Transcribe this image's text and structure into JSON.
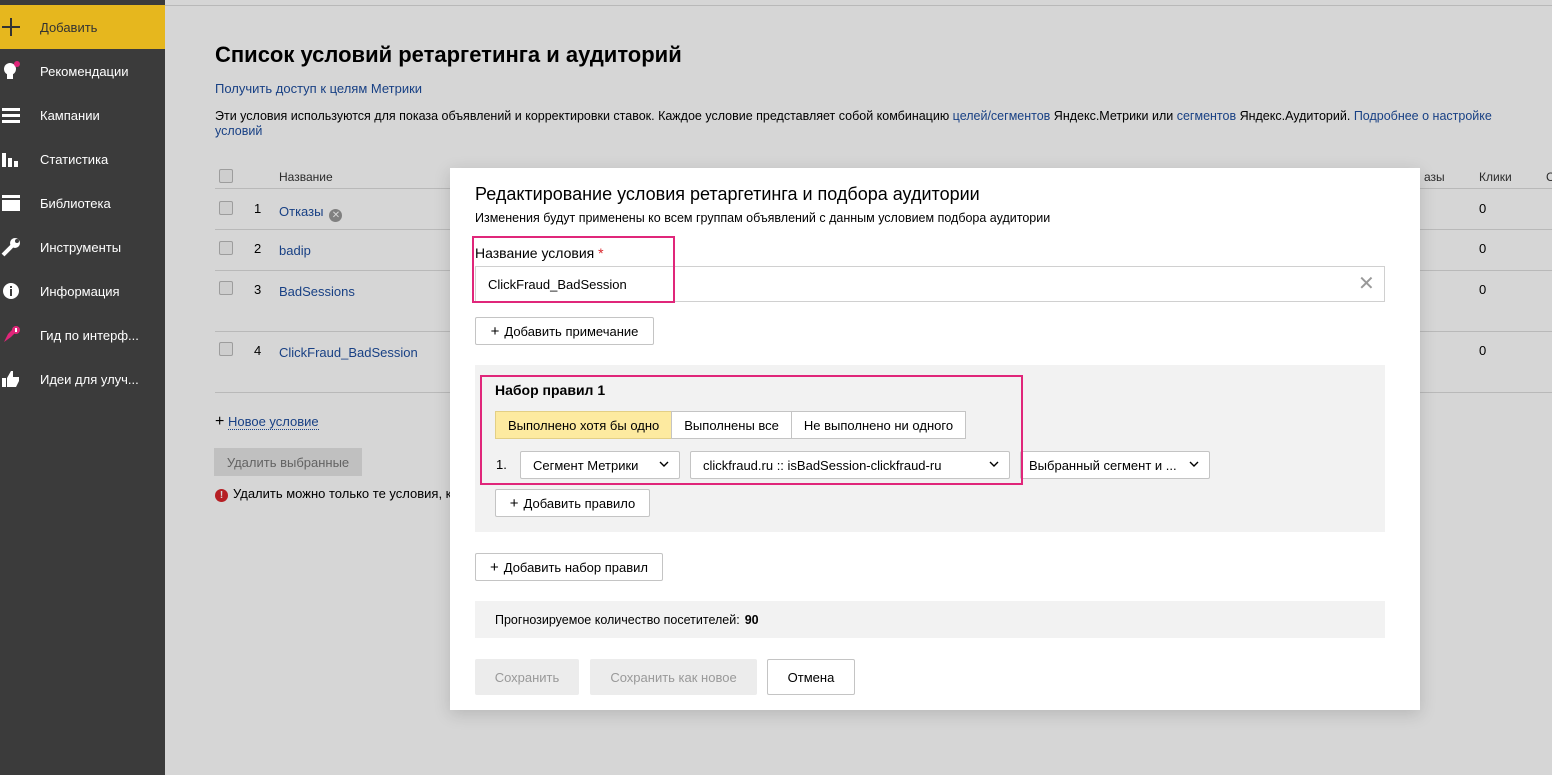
{
  "sidebar": {
    "items": [
      {
        "label": "Добавить",
        "icon": "plus-icon"
      },
      {
        "label": "Рекомендации",
        "icon": "lightbulb-icon"
      },
      {
        "label": "Кампании",
        "icon": "list-icon"
      },
      {
        "label": "Статистика",
        "icon": "bar-chart-icon"
      },
      {
        "label": "Библиотека",
        "icon": "library-icon"
      },
      {
        "label": "Инструменты",
        "icon": "wrench-icon"
      },
      {
        "label": "Информация",
        "icon": "info-icon"
      },
      {
        "label": "Гид по интерф...",
        "icon": "rocket-icon"
      },
      {
        "label": "Идеи для улуч...",
        "icon": "thumbs-up-icon"
      }
    ]
  },
  "page": {
    "title": "Список условий ретаргетинга и аудиторий",
    "metrika_link": "Получить доступ к целям Метрики",
    "desc": {
      "part1": "Эти условия используются для показа объявлений и корректировки ставок. Каждое условие представляет собой комбинацию ",
      "link1": "целей/сегментов",
      "part2": " Яндекс.Метрики или ",
      "link2": "сегментов",
      "part3": " Яндекс.Аудиторий. ",
      "link3": "Подробнее о настройке",
      "link3_cont": "условий"
    }
  },
  "table": {
    "headers": {
      "name": "Название",
      "orders": "азы",
      "clicks": "Клики",
      "last": "С"
    },
    "rows": [
      {
        "num": "1",
        "name": "Отказы",
        "clicks": "0"
      },
      {
        "num": "2",
        "name": "badip",
        "clicks": "0"
      },
      {
        "num": "3",
        "name": "BadSessions",
        "clicks": "0"
      },
      {
        "num": "4",
        "name": "ClickFraud_BadSession",
        "clicks": "0"
      }
    ]
  },
  "actions": {
    "new_condition": "Новое условие",
    "delete_selected": "Удалить выбранные",
    "warning": "Удалить можно только те условия, к"
  },
  "modal": {
    "title": "Редактирование условия ретаргетинга и подбора аудитории",
    "subtitle": "Изменения будут применены ко всем группам объявлений с данным условием подбора аудитории",
    "name_label": "Название условия",
    "required_mark": "*",
    "name_value": "ClickFraud_BadSession",
    "add_note": "Добавить примечание",
    "ruleset": {
      "title": "Набор правил 1",
      "modes": [
        "Выполнено хотя бы одно",
        "Выполнены все",
        "Не выполнено ни одного"
      ],
      "rule_num": "1.",
      "source_select": "Сегмент Метрики",
      "segment_select": "clickfraud.ru :: isBadSession-clickfraud-ru",
      "period_select": "Выбранный сегмент и ...",
      "add_rule": "Добавить правило"
    },
    "add_ruleset": "Добавить набор правил",
    "forecast_label": "Прогнозируемое количество посетителей:",
    "forecast_value": "90",
    "save": "Сохранить",
    "save_as_new": "Сохранить как новое",
    "cancel": "Отмена"
  },
  "colors": {
    "accent": "#e6b71e",
    "highlight": "#e0267a",
    "link": "#1d4d9e",
    "sidebar": "#3b3b3b"
  }
}
